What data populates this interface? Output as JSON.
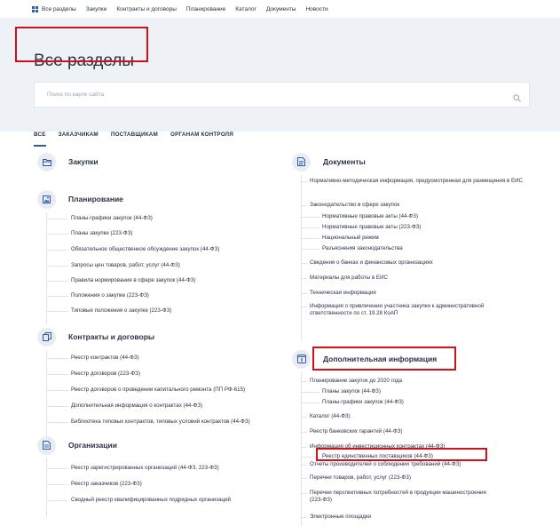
{
  "nav": {
    "items": [
      "Все разделы",
      "Закупки",
      "Контракты и договоры",
      "Планирование",
      "Каталог",
      "Документы",
      "Новости"
    ]
  },
  "hero": {
    "title": "Все разделы",
    "search_placeholder": "Поиск по карте сайта"
  },
  "tabs": [
    "ВСЕ",
    "ЗАКАЗЧИКАМ",
    "ПОСТАВЩИКАМ",
    "ОРГАНАМ КОНТРОЛЯ"
  ],
  "highlight_color": "#d0101a",
  "accent_color": "#2b5aa8",
  "left": {
    "zakupki": {
      "title": "Закупки",
      "icon": "folder-icon"
    },
    "planning": {
      "title": "Планирование",
      "icon": "picture-icon",
      "items": [
        "Планы-графики закупок (44-ФЗ)",
        "Планы закупки (223-ФЗ)",
        "Обязательное общественное обсуждение закупок (44-ФЗ)",
        "Запросы цен товаров, работ, услуг (44-ФЗ)",
        "Правила нормирования в сфере закупок (44-ФЗ)",
        "Положения о закупке (223-ФЗ)",
        "Типовые положения о закупке (223-ФЗ)"
      ]
    },
    "contracts": {
      "title": "Контракты и договоры",
      "icon": "copy-icon",
      "items": [
        "Реестр контрактов (44-ФЗ)",
        "Реестр договоров (223-ФЗ)",
        "Реестр договоров о проведении капитального ремонта (ПП РФ-615)",
        "Дополнительная информация о контрактах (44-ФЗ)",
        "Библиотека типовых контрактов, типовых условий контрактов (44-ФЗ)"
      ]
    },
    "orgs": {
      "title": "Организации",
      "icon": "document-icon",
      "items": [
        "Реестр зарегистрированных организаций (44-ФЗ, 223-ФЗ)",
        "Реестр заказчиков (223-ФЗ)",
        "Сводный реестр квалифицированных подрядных организаций"
      ]
    }
  },
  "right": {
    "docs": {
      "title": "Документы",
      "icon": "file-icon",
      "items": [
        "Нормативно-методическая информация, предусмотренная для размещения в ЕИС",
        "Законодательство в сфере закупок",
        "Нормативные правовые акты (44-ФЗ)",
        "Нормативные правовые акты (223-ФЗ)",
        "Национальный режим",
        "Разъяснения законодательства",
        "Сведения о банках и финансовых организациях",
        "Материалы для работы в ЕИС",
        "Техническая информация",
        "Информация о привлечении участника закупки к административной ответственности по ст. 19.28 КоАП"
      ]
    },
    "extra": {
      "title": "Дополнительная информация",
      "icon": "info-icon",
      "items": [
        "Планирование закупок до 2020 года",
        "Планы закупок (44-ФЗ)",
        "Планы-графики закупок (44-ФЗ)",
        "Каталог (44-ФЗ)",
        "Реестр банковских гарантий (44-ФЗ)",
        "Информация об инвестиционных контрактах (44-ФЗ)",
        "Реестр единственных поставщиков (44-ФЗ)",
        "Отчеты производителей о соблюдении требований (44-ФЗ)",
        "Перечни товаров, работ, услуг (223-ФЗ)",
        "Перечни перспективных потребностей в продукции машиностроения (223-ФЗ)",
        "Электронные площадки"
      ]
    }
  }
}
